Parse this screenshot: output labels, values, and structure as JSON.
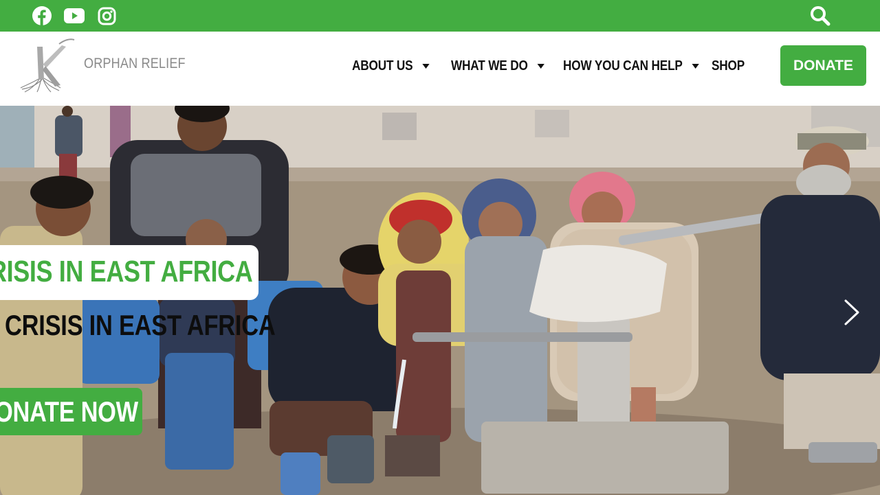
{
  "topbar": {
    "background": "#43ad41",
    "social_icons": [
      "facebook-icon",
      "youtube-icon",
      "instagram-icon"
    ],
    "search_icon": "search-icon"
  },
  "header": {
    "logo_text": "ORPHAN RELIEF",
    "nav": [
      {
        "label": "ABOUT US",
        "has_dropdown": true
      },
      {
        "label": "WHAT WE DO",
        "has_dropdown": true
      },
      {
        "label": "HOW YOU CAN HELP",
        "has_dropdown": true
      },
      {
        "label": "SHOP",
        "has_dropdown": false
      }
    ],
    "donate_label": "DONATE"
  },
  "hero": {
    "headline": "RISIS IN EAST AFRICA",
    "subheadline": "CRISIS IN EAST AFRICA",
    "cta_label": "ONATE NOW",
    "next_icon": "chevron-right-icon",
    "accent": "#43ad41"
  }
}
